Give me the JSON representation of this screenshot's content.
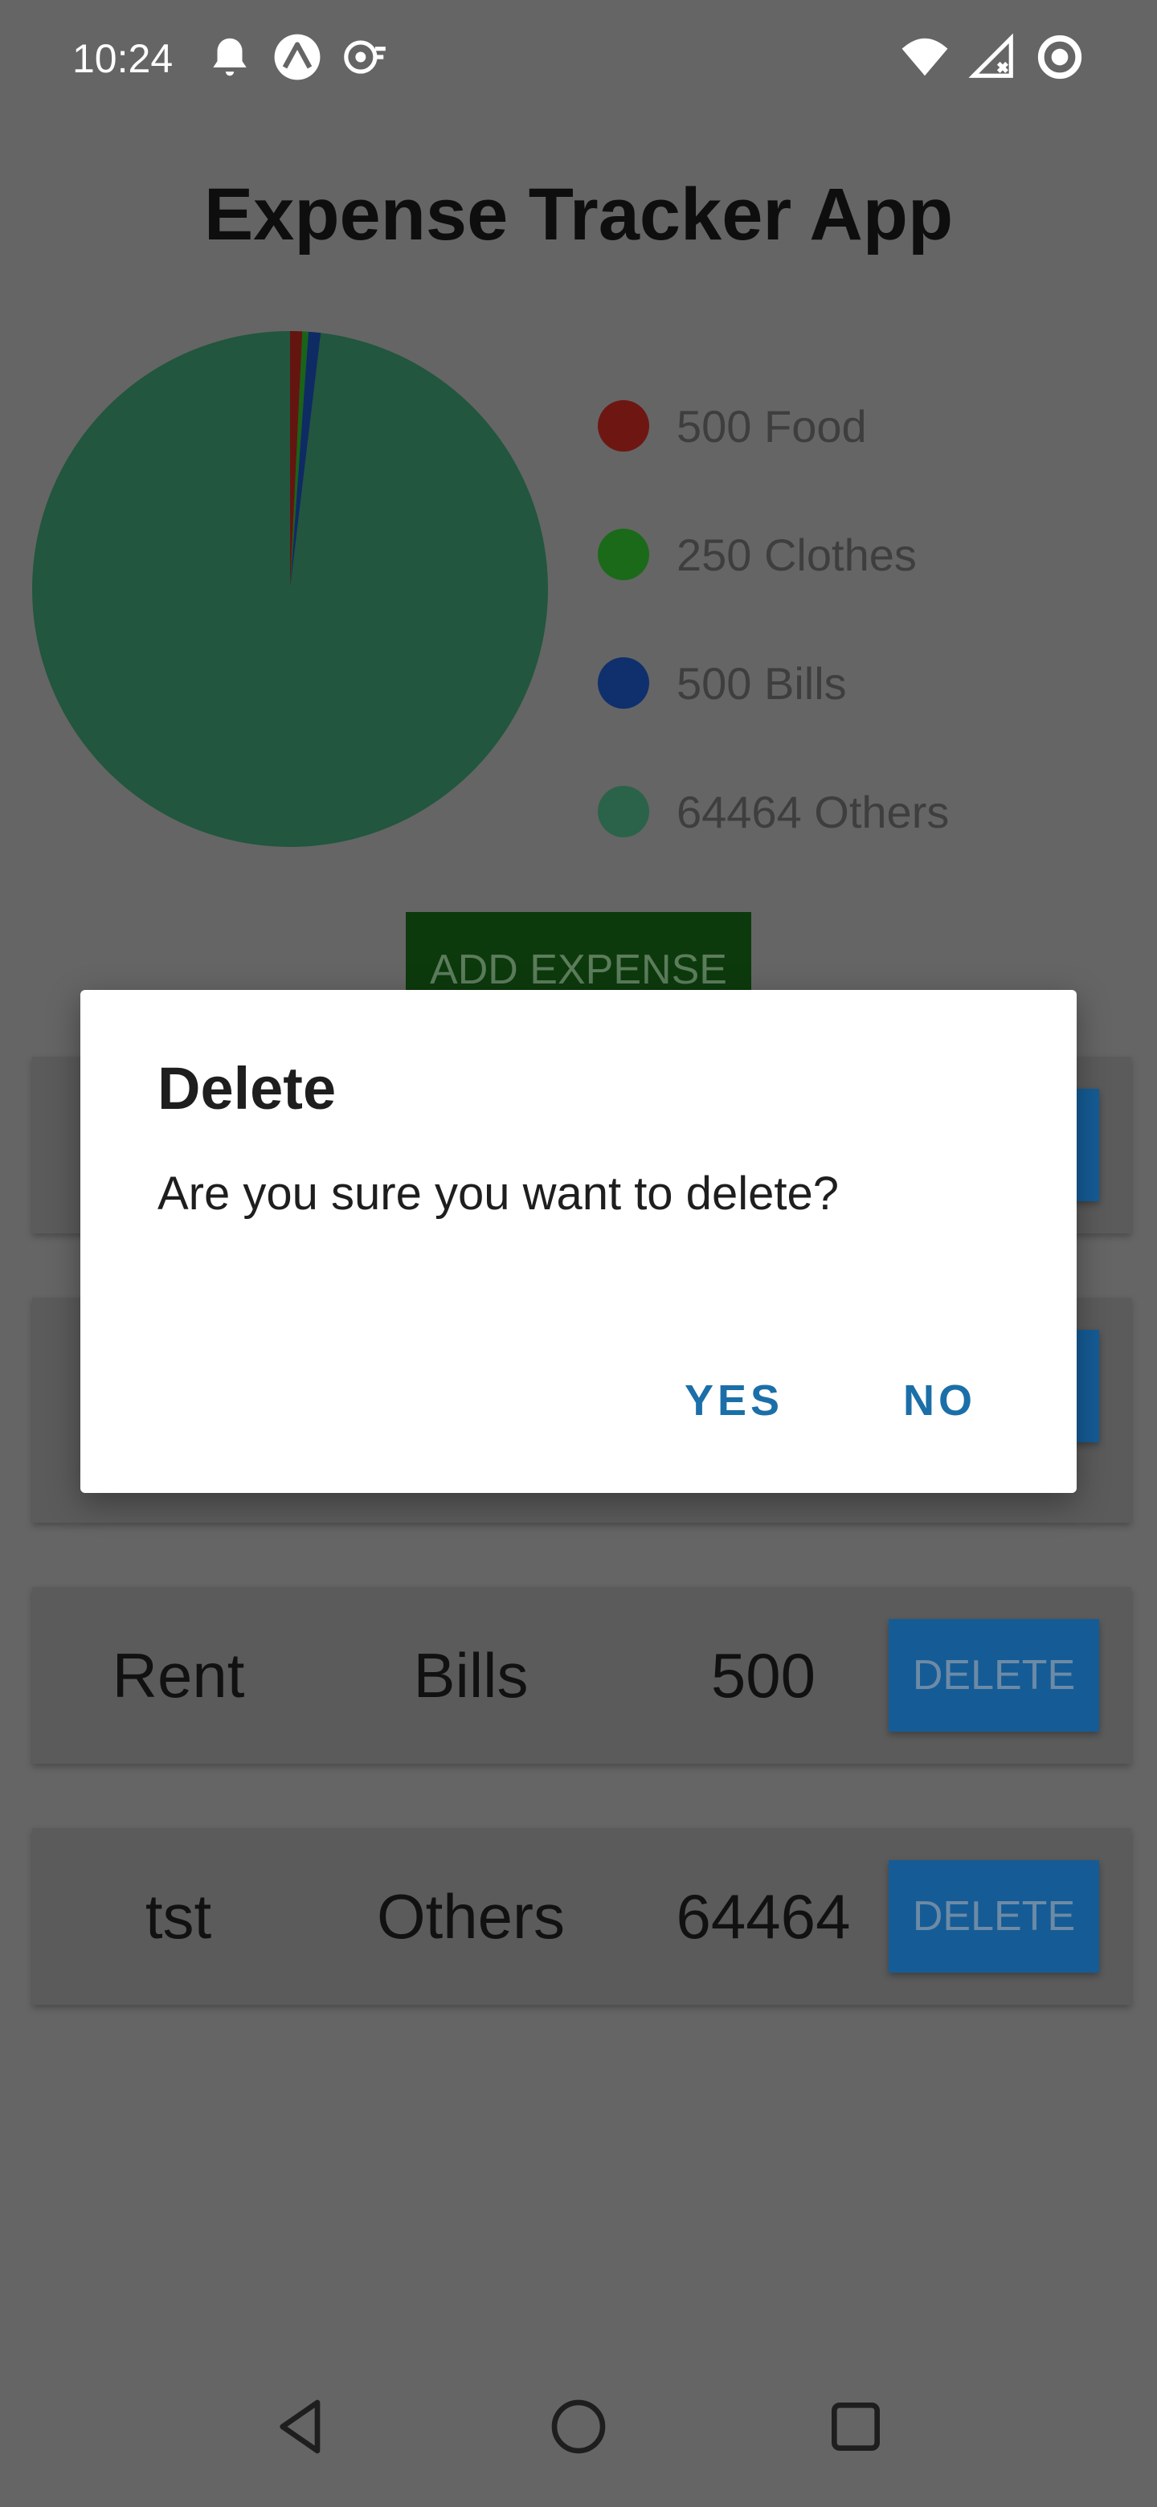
{
  "status_bar": {
    "time": "10:24",
    "left_icons": [
      "notification-bell-icon",
      "expo-icon",
      "settings-icon"
    ],
    "right_icons": [
      "wifi-icon",
      "signal-icon",
      "battery-icon"
    ]
  },
  "app": {
    "title": "Expense Tracker App",
    "add_button_label": "ADD EXPENSE"
  },
  "chart_data": {
    "type": "pie",
    "slices": [
      {
        "label": "Food",
        "value": 500,
        "color": "#7a1a14"
      },
      {
        "label": "Clothes",
        "value": 250,
        "color": "#1f7a1f"
      },
      {
        "label": "Bills",
        "value": 500,
        "color": "#12357a"
      },
      {
        "label": "Others",
        "value": 64464,
        "color": "#2a6a4c"
      }
    ]
  },
  "legend": [
    {
      "text": "500 Food",
      "color": "#6e1712"
    },
    {
      "text": "250 Clothes",
      "color": "#1a6a1a"
    },
    {
      "text": "500 Bills",
      "color": "#0f306c"
    },
    {
      "text": "64464 Others",
      "color": "#2a6349"
    }
  ],
  "expenses": [
    {
      "name": "Rent",
      "category": "Bills",
      "amount": "500",
      "delete_label": "DELETE"
    },
    {
      "name": "tst",
      "category": "Others",
      "amount": "64464",
      "delete_label": "DELETE"
    }
  ],
  "dialog": {
    "title": "Delete",
    "message": "Are you sure you want to delete?",
    "yes_label": "YES",
    "no_label": "NO"
  },
  "navigation": [
    "back-icon",
    "home-icon",
    "recents-icon"
  ]
}
